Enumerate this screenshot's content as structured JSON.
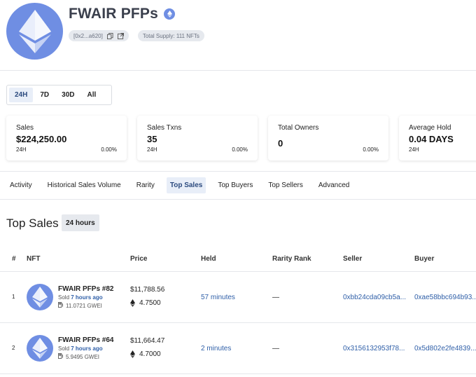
{
  "collection": {
    "name": "FWAIR PFPs",
    "address": "[0x2...a620]",
    "supply": "Total Supply: 111 NFTs"
  },
  "periods": [
    "24H",
    "7D",
    "30D",
    "All"
  ],
  "active_period": "24H",
  "stats": [
    {
      "label": "Sales",
      "value": "$224,250.00",
      "sub": "24H",
      "pct": "0.00%"
    },
    {
      "label": "Sales Txns",
      "value": "35",
      "sub": "24H",
      "pct": "0.00%"
    },
    {
      "label": "Total Owners",
      "value": "0",
      "sub": "",
      "pct": "0.00%"
    },
    {
      "label": "Average Hold",
      "value": "0.04 DAYS",
      "sub": "24H",
      "pct": ""
    }
  ],
  "tabs": [
    "Activity",
    "Historical Sales Volume",
    "Rarity",
    "Top Sales",
    "Top Buyers",
    "Top Sellers",
    "Advanced"
  ],
  "active_tab": "Top Sales",
  "section": {
    "title": "Top Sales",
    "range": "24 hours"
  },
  "table": {
    "columns": [
      "#",
      "NFT",
      "Price",
      "Held",
      "Rarity Rank",
      "Seller",
      "Buyer"
    ],
    "rows": [
      {
        "index": "1",
        "name": "FWAIR PFPs #82",
        "sold_prefix": "Sold",
        "sold_time": "7 hours ago",
        "gwei": "11.0721 GWEI",
        "price_usd": "$11,788.56",
        "price_eth": "4.7500",
        "held": "57 minutes",
        "rarity": "—",
        "seller": "0xbb24cda09cb5a...",
        "buyer": "0xae58bbc694b93..."
      },
      {
        "index": "2",
        "name": "FWAIR PFPs #64",
        "sold_prefix": "Sold",
        "sold_time": "7 hours ago",
        "gwei": "5.9495 GWEI",
        "price_usd": "$11,664.47",
        "price_eth": "4.7000",
        "held": "2 minutes",
        "rarity": "—",
        "seller": "0x3156132953f78...",
        "buyer": "0x5d802e2fe4839..."
      }
    ]
  },
  "colors": {
    "accent": "#6f8ee3",
    "link": "#2f5fa8",
    "active_bg": "#e8eef8"
  }
}
